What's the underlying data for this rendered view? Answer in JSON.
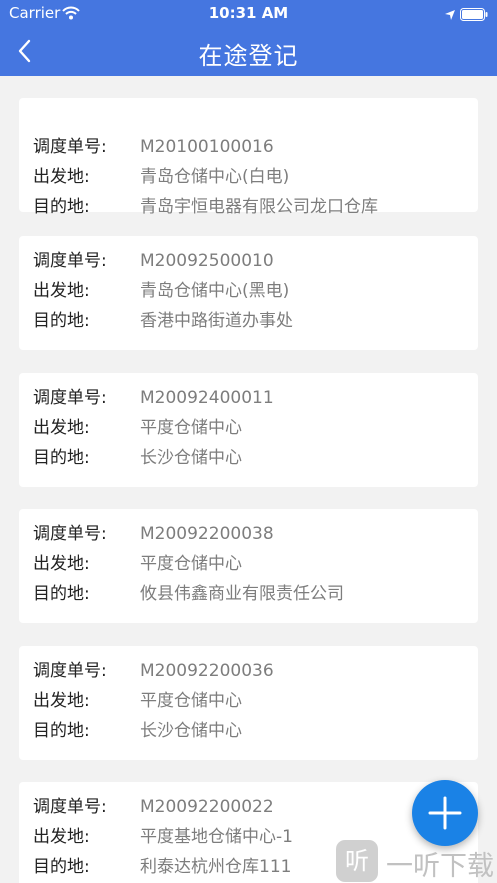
{
  "status_bar": {
    "carrier": "Carrier",
    "time": "10:31 AM"
  },
  "nav": {
    "title": "在途登记"
  },
  "labels": {
    "order_no": "调度单号:",
    "origin": "出发地:",
    "destination": "目的地:"
  },
  "records": [
    {
      "order_no": "M20100100016",
      "origin": "青岛仓储中心(白电)",
      "destination": "青岛宇恒电器有限公司龙口仓库"
    },
    {
      "order_no": "M20092500010",
      "origin": "青岛仓储中心(黑电)",
      "destination": "香港中路街道办事处"
    },
    {
      "order_no": "M20092400011",
      "origin": "平度仓储中心",
      "destination": "长沙仓储中心"
    },
    {
      "order_no": "M20092200038",
      "origin": "平度仓储中心",
      "destination": "攸县伟鑫商业有限责任公司"
    },
    {
      "order_no": "M20092200036",
      "origin": "平度仓储中心",
      "destination": "长沙仓储中心"
    },
    {
      "order_no": "M20092200022",
      "origin": "平度基地仓储中心-1",
      "destination": "利泰达杭州仓库111"
    }
  ],
  "watermark": {
    "icon_text": "听",
    "text": "一听下载"
  },
  "colors": {
    "header": "#4576e0",
    "fab": "#1a82e6",
    "value_text": "#7d7d7d"
  },
  "icons": {
    "back": "chevron-left-icon",
    "add": "plus-icon",
    "wifi": "wifi-icon",
    "location": "location-arrow-icon",
    "battery": "battery-icon"
  }
}
